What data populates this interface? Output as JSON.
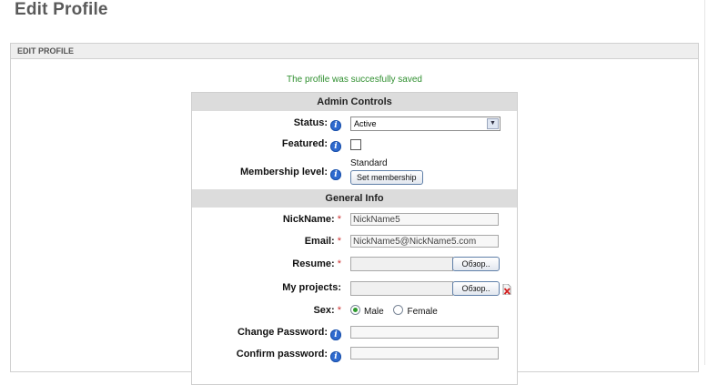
{
  "page": {
    "title": "Edit Profile"
  },
  "panel": {
    "header": "EDIT PROFILE"
  },
  "status_message": "The profile was succesfully saved",
  "admin_controls": {
    "title": "Admin Controls",
    "status_label": "Status:",
    "status_value": "Active",
    "featured_label": "Featured:",
    "featured_checked": false,
    "membership_label": "Membership level:",
    "membership_value": "Standard",
    "set_membership_label": "Set membership"
  },
  "general_info": {
    "title": "General Info",
    "nickname_label": "NickName:",
    "nickname_value": "NickName5",
    "email_label": "Email:",
    "email_value": "NickName5@NickName5.com",
    "resume_label": "Resume:",
    "browse_label": "Обзор..",
    "projects_label": "My projects:",
    "sex_label": "Sex:",
    "sex_options": [
      "Male",
      "Female"
    ],
    "sex_selected": "Male",
    "change_password_label": "Change Password:",
    "confirm_password_label": "Confirm password:",
    "required_mark": "*"
  },
  "colors": {
    "success": "#2f8f2f",
    "info_icon": "#2f6bd0",
    "required": "#cc3333"
  }
}
